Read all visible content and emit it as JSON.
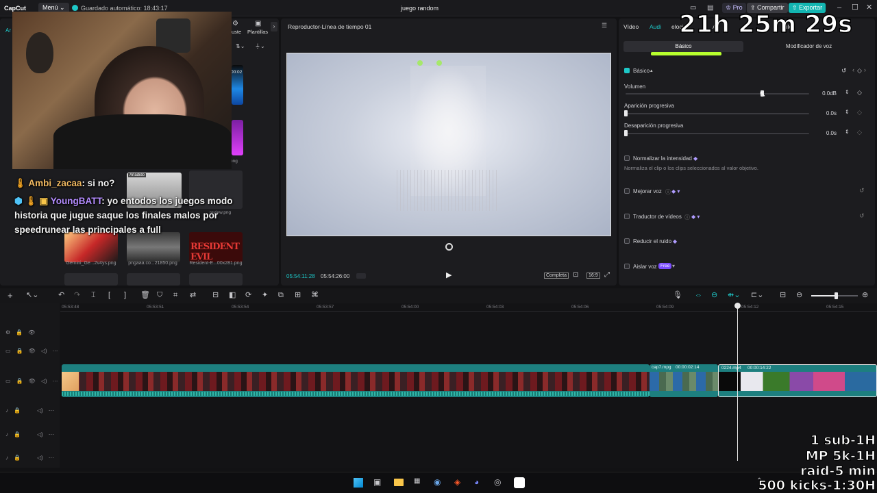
{
  "titlebar": {
    "app_name": "CapCut",
    "menu_label": "Menú",
    "autosave": "Guardado automático: 18:43:17",
    "project_title": "juego random",
    "pro_label": "Pro",
    "share_label": "Compartir",
    "export_label": "Exportar"
  },
  "media": {
    "tab_partial_1": "Ar",
    "tab_partial_2": "uste",
    "tab_templates": "Plantillas",
    "added_badge": "Añadido",
    "items": [
      {
        "label": "Gemini_Ge...2v4ys.png"
      },
      {
        "label": "pngaaa.co...21850.png"
      },
      {
        "label": "Resident-E...00x281.png"
      }
    ],
    "side_labels": [
      "00:02",
      "review.png",
      "png"
    ]
  },
  "player": {
    "title": "Reproductor-Línea de tiempo 01",
    "current_time": "05:54:11:28",
    "total_time": "05:54:26:00",
    "full_label": "Completa",
    "ratio_label": "16:9"
  },
  "props": {
    "tab_video": "Vídeo",
    "tab_audio": "Audi",
    "tab_partial_3": "elocid",
    "tab_partial_4": "A",
    "tab_partial_5": "stilo",
    "subtab_basic": "Básico",
    "subtab_voice": "Modificador de voz",
    "section_basic": "Básico",
    "volume_label": "Volumen",
    "volume_value": "0.0dB",
    "fadein_label": "Aparición progresiva",
    "fadein_value": "0.0s",
    "fadeout_label": "Desaparición progresiva",
    "fadeout_value": "0.0s",
    "normalize_label": "Normalizar la intensidad",
    "normalize_desc": "Normaliza el clip o los clips seleccionados al valor objetivo.",
    "enhance_label": "Mejorar voz",
    "translate_label": "Traductor de vídeos",
    "denoise_label": "Reducir el ruido",
    "isolate_label": "Aislar voz",
    "free_badge": "Free"
  },
  "timeline": {
    "ruler": [
      "05:53:48",
      "05:53:51",
      "05:53:54",
      "05:53:57",
      "05:54:00",
      "05:54:03",
      "05:54:06",
      "05:54:09",
      "05:54:12",
      "05:54:15"
    ],
    "clip1_label": "cap7.mpg",
    "clip1_duration": "00:00:02:14",
    "clip2_label": "0224.mp4",
    "clip2_duration": "00:00:14:22"
  },
  "overlay": {
    "timer": "21h 25m 29s",
    "chat": [
      {
        "user": "Ambi_zacaa",
        "message": ": si no?",
        "user_color": "#f0b860"
      },
      {
        "user": "YoungBATT",
        "message": ": yo entodos los juegos modo",
        "user_color": "#b48cff"
      }
    ],
    "chat_cont_1": "historia que jugue saque los finales malos por",
    "chat_cont_2": "speedrunear las principales a full",
    "goals": [
      "1 sub-1H",
      "MP 5k-1H",
      "raid-5 min",
      "500 kicks-1:30H"
    ]
  },
  "colors": {
    "accent": "#1ec8c8",
    "export_bg": "#13b5b1",
    "green_bar": "#b8ff2e",
    "clip_teal": "#1f8a8a",
    "playhead": "#e8e8e8"
  }
}
